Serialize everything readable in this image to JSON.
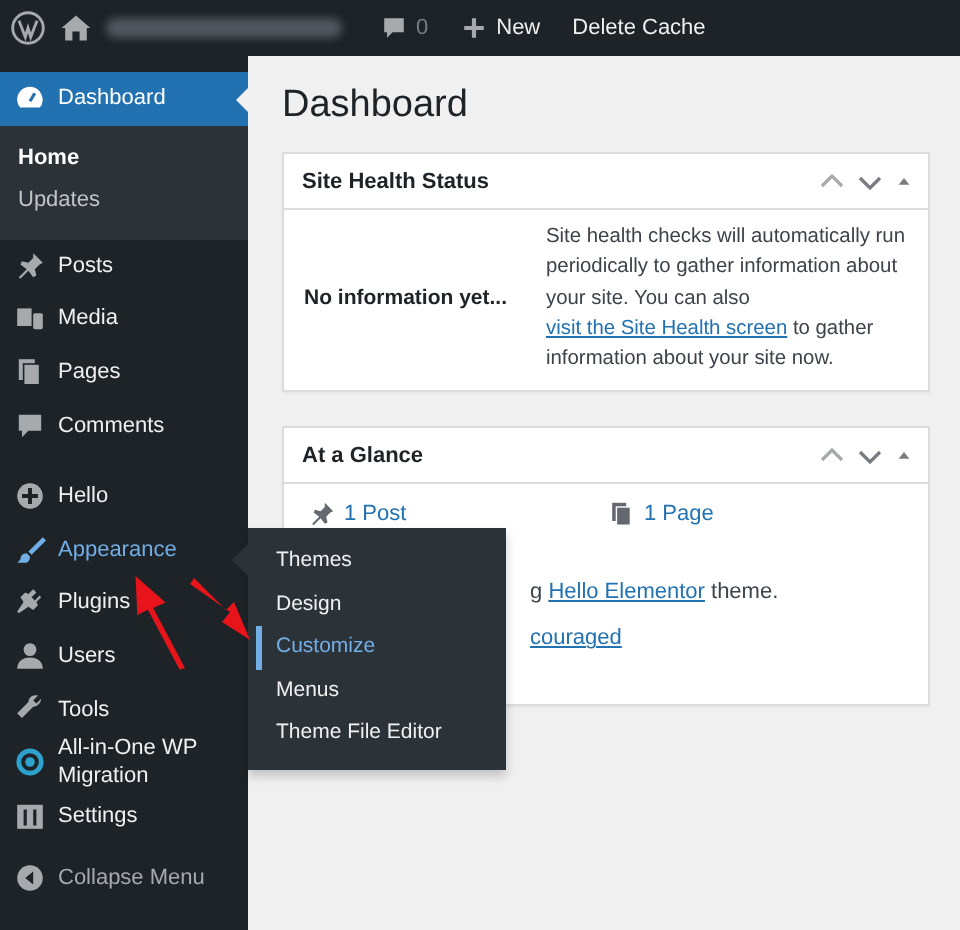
{
  "admin_bar": {
    "comments_count": "0",
    "new_label": "New",
    "cache_label": "Delete Cache"
  },
  "sidebar": {
    "groups": [
      [
        {
          "label": "Dashboard",
          "current": true,
          "hovered": false,
          "children": [
            {
              "label": "Home",
              "current": true
            },
            {
              "label": "Updates",
              "current": false
            }
          ]
        }
      ],
      [
        {
          "label": "Posts",
          "current": false,
          "hovered": false
        },
        {
          "label": "Media",
          "current": false,
          "hovered": false
        },
        {
          "label": "Pages",
          "current": false,
          "hovered": false
        },
        {
          "label": "Comments",
          "current": false,
          "hovered": false
        }
      ],
      [
        {
          "label": "Hello",
          "current": false,
          "hovered": false
        },
        {
          "label": "Appearance",
          "current": false,
          "hovered": true
        },
        {
          "label": "Plugins",
          "current": false,
          "hovered": false
        },
        {
          "label": "Users",
          "current": false,
          "hovered": false
        },
        {
          "label": "Tools",
          "current": false,
          "hovered": false
        },
        {
          "label": "All-in-One WP Migration",
          "current": false,
          "hovered": false
        },
        {
          "label": "Settings",
          "current": false,
          "hovered": false
        }
      ]
    ],
    "collapse_label": "Collapse Menu"
  },
  "flyout": {
    "items": [
      {
        "label": "Themes",
        "selected": false
      },
      {
        "label": "Design",
        "selected": false
      },
      {
        "label": "Customize",
        "selected": true
      },
      {
        "label": "Menus",
        "selected": false
      },
      {
        "label": "Theme File Editor",
        "selected": false
      }
    ]
  },
  "page_title": "Dashboard",
  "site_health": {
    "title": "Site Health Status",
    "status": "No information yet...",
    "text_before": "Site health checks will automatically run periodically to gather information about your site. You can also ",
    "link": "visit the Site Health screen",
    "text_after": " to gather information about your site now."
  },
  "glance": {
    "title": "At a Glance",
    "counts": [
      {
        "label": "1 Post"
      },
      {
        "label": "1 Page"
      }
    ],
    "theme_before": "g ",
    "theme_link": "Hello Elementor",
    "theme_after": " theme.",
    "partial_link": "couraged"
  }
}
